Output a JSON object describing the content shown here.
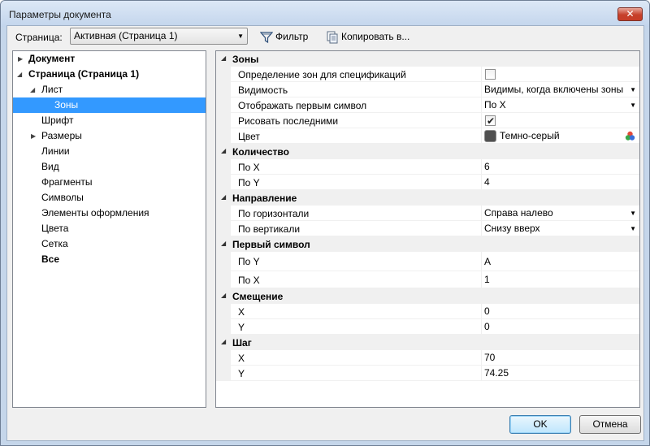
{
  "window": {
    "title": "Параметры документа",
    "close_label": "✕"
  },
  "toolbar": {
    "page_label": "Страница:",
    "page_select_value": "Активная (Страница 1)",
    "filter_label": "Фильтр",
    "copy_label": "Копировать в..."
  },
  "tree": [
    {
      "label": "Документ",
      "bold": true,
      "has_arrow": true
    },
    {
      "label": "Страница (Страница 1)",
      "bold": true,
      "has_arrow": true,
      "expanded": true
    },
    {
      "label": "Лист",
      "has_arrow": true,
      "expanded": true
    },
    {
      "label": "Зоны",
      "selected": true
    },
    {
      "label": "Шрифт"
    },
    {
      "label": "Размеры",
      "has_arrow": true
    },
    {
      "label": "Линии"
    },
    {
      "label": "Вид"
    },
    {
      "label": "Фрагменты"
    },
    {
      "label": "Символы"
    },
    {
      "label": "Элементы оформления"
    },
    {
      "label": "Цвета"
    },
    {
      "label": "Сетка"
    },
    {
      "label": "Все",
      "bold": true
    }
  ],
  "grid": {
    "cat_zones": "Зоны",
    "zones_spec": "Определение зон для спецификаций",
    "zones_spec_checked": false,
    "zones_visibility": "Видимость",
    "zones_visibility_value": "Видимы, когда включены зоны",
    "zones_first_symbol": "Отображать первым символ",
    "zones_first_symbol_value": "По X",
    "zones_draw_last": "Рисовать последними",
    "zones_draw_last_checked": true,
    "zones_color": "Цвет",
    "zones_color_value": "Темно-серый",
    "zones_color_hex": "#505050",
    "cat_count": "Количество",
    "count_x": "По X",
    "count_x_value": "6",
    "count_y": "По Y",
    "count_y_value": "4",
    "cat_direction": "Направление",
    "dir_h": "По горизонтали",
    "dir_h_value": "Справа налево",
    "dir_v": "По вертикали",
    "dir_v_value": "Снизу вверх",
    "cat_first_symbol": "Первый символ",
    "fs_y": "По Y",
    "fs_y_value": "А",
    "fs_x": "По X",
    "fs_x_value": "1",
    "cat_offset": "Смещение",
    "offset_x": "X",
    "offset_x_value": "0",
    "offset_y": "Y",
    "offset_y_value": "0",
    "cat_step": "Шаг",
    "step_x": "X",
    "step_x_value": "70",
    "step_y": "Y",
    "step_y_value": "74.25"
  },
  "buttons": {
    "ok": "OK",
    "cancel": "Отмена"
  }
}
